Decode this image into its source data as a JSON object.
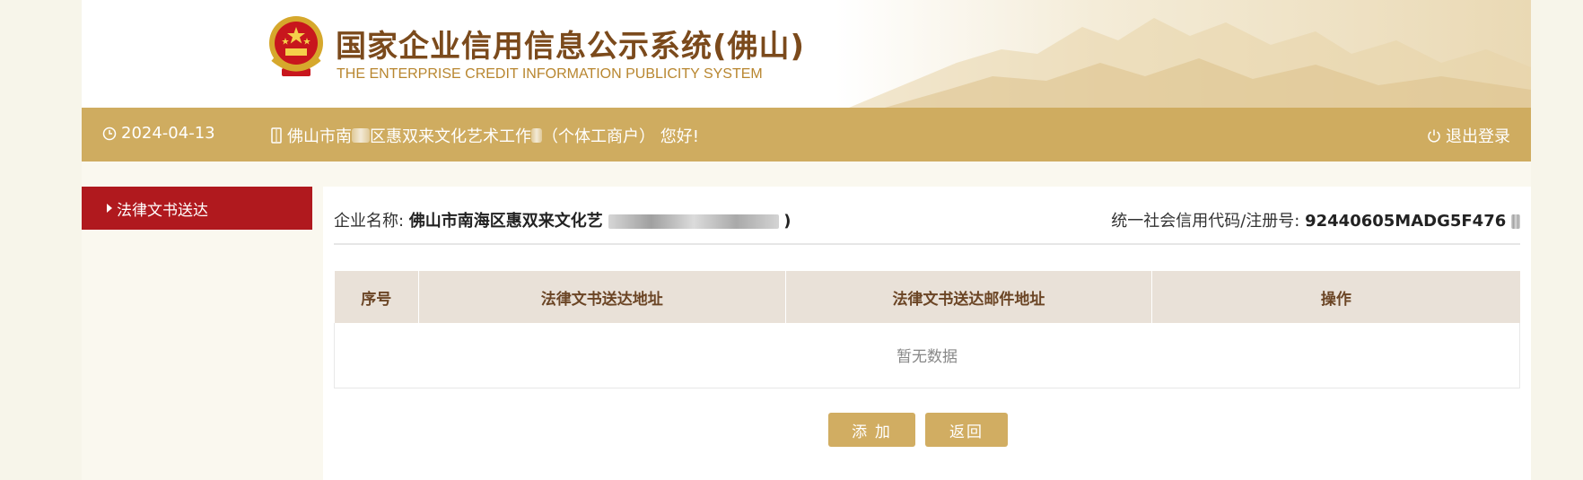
{
  "header": {
    "title_cn": "国家企业信用信息公示系统(佛山)",
    "title_en": "THE ENTERPRISE CREDIT INFORMATION PUBLICITY SYSTEM"
  },
  "topbar": {
    "date": "2024-04-13",
    "user_prefix": "佛山市南",
    "user_mid": "区惠双来文化艺术工作",
    "user_suffix": "（个体工商户） 您好!",
    "logout_label": "退出登录"
  },
  "sidebar": {
    "items": [
      {
        "label": "法律文书送达"
      }
    ]
  },
  "info": {
    "name_label": "企业名称:",
    "name_value": "佛山市南海区惠双来文化艺",
    "name_tail": ")",
    "code_label": "统一社会信用代码/注册号:",
    "code_value": "92440605MADG5F476"
  },
  "table": {
    "columns": [
      "序号",
      "法律文书送达地址",
      "法律文书送达邮件地址",
      "操作"
    ],
    "empty_text": "暂无数据"
  },
  "buttons": {
    "add": "添 加",
    "back": "返回"
  },
  "colors": {
    "topbar": "#cfac60",
    "sidebar_active": "#b0191e",
    "table_header": "#e9e1d8",
    "button": "#d1ad62"
  }
}
